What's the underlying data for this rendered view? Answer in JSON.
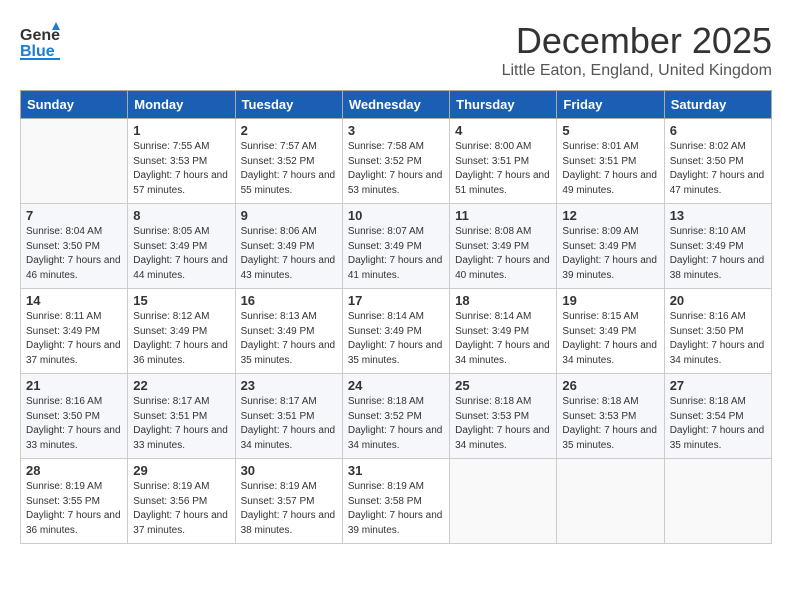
{
  "header": {
    "logo_line1": "General",
    "logo_line2": "Blue",
    "month": "December 2025",
    "location": "Little Eaton, England, United Kingdom"
  },
  "days_of_week": [
    "Sunday",
    "Monday",
    "Tuesday",
    "Wednesday",
    "Thursday",
    "Friday",
    "Saturday"
  ],
  "weeks": [
    [
      {
        "day": "",
        "sunrise": "",
        "sunset": "",
        "daylight": ""
      },
      {
        "day": "1",
        "sunrise": "Sunrise: 7:55 AM",
        "sunset": "Sunset: 3:53 PM",
        "daylight": "Daylight: 7 hours and 57 minutes."
      },
      {
        "day": "2",
        "sunrise": "Sunrise: 7:57 AM",
        "sunset": "Sunset: 3:52 PM",
        "daylight": "Daylight: 7 hours and 55 minutes."
      },
      {
        "day": "3",
        "sunrise": "Sunrise: 7:58 AM",
        "sunset": "Sunset: 3:52 PM",
        "daylight": "Daylight: 7 hours and 53 minutes."
      },
      {
        "day": "4",
        "sunrise": "Sunrise: 8:00 AM",
        "sunset": "Sunset: 3:51 PM",
        "daylight": "Daylight: 7 hours and 51 minutes."
      },
      {
        "day": "5",
        "sunrise": "Sunrise: 8:01 AM",
        "sunset": "Sunset: 3:51 PM",
        "daylight": "Daylight: 7 hours and 49 minutes."
      },
      {
        "day": "6",
        "sunrise": "Sunrise: 8:02 AM",
        "sunset": "Sunset: 3:50 PM",
        "daylight": "Daylight: 7 hours and 47 minutes."
      }
    ],
    [
      {
        "day": "7",
        "sunrise": "Sunrise: 8:04 AM",
        "sunset": "Sunset: 3:50 PM",
        "daylight": "Daylight: 7 hours and 46 minutes."
      },
      {
        "day": "8",
        "sunrise": "Sunrise: 8:05 AM",
        "sunset": "Sunset: 3:49 PM",
        "daylight": "Daylight: 7 hours and 44 minutes."
      },
      {
        "day": "9",
        "sunrise": "Sunrise: 8:06 AM",
        "sunset": "Sunset: 3:49 PM",
        "daylight": "Daylight: 7 hours and 43 minutes."
      },
      {
        "day": "10",
        "sunrise": "Sunrise: 8:07 AM",
        "sunset": "Sunset: 3:49 PM",
        "daylight": "Daylight: 7 hours and 41 minutes."
      },
      {
        "day": "11",
        "sunrise": "Sunrise: 8:08 AM",
        "sunset": "Sunset: 3:49 PM",
        "daylight": "Daylight: 7 hours and 40 minutes."
      },
      {
        "day": "12",
        "sunrise": "Sunrise: 8:09 AM",
        "sunset": "Sunset: 3:49 PM",
        "daylight": "Daylight: 7 hours and 39 minutes."
      },
      {
        "day": "13",
        "sunrise": "Sunrise: 8:10 AM",
        "sunset": "Sunset: 3:49 PM",
        "daylight": "Daylight: 7 hours and 38 minutes."
      }
    ],
    [
      {
        "day": "14",
        "sunrise": "Sunrise: 8:11 AM",
        "sunset": "Sunset: 3:49 PM",
        "daylight": "Daylight: 7 hours and 37 minutes."
      },
      {
        "day": "15",
        "sunrise": "Sunrise: 8:12 AM",
        "sunset": "Sunset: 3:49 PM",
        "daylight": "Daylight: 7 hours and 36 minutes."
      },
      {
        "day": "16",
        "sunrise": "Sunrise: 8:13 AM",
        "sunset": "Sunset: 3:49 PM",
        "daylight": "Daylight: 7 hours and 35 minutes."
      },
      {
        "day": "17",
        "sunrise": "Sunrise: 8:14 AM",
        "sunset": "Sunset: 3:49 PM",
        "daylight": "Daylight: 7 hours and 35 minutes."
      },
      {
        "day": "18",
        "sunrise": "Sunrise: 8:14 AM",
        "sunset": "Sunset: 3:49 PM",
        "daylight": "Daylight: 7 hours and 34 minutes."
      },
      {
        "day": "19",
        "sunrise": "Sunrise: 8:15 AM",
        "sunset": "Sunset: 3:49 PM",
        "daylight": "Daylight: 7 hours and 34 minutes."
      },
      {
        "day": "20",
        "sunrise": "Sunrise: 8:16 AM",
        "sunset": "Sunset: 3:50 PM",
        "daylight": "Daylight: 7 hours and 34 minutes."
      }
    ],
    [
      {
        "day": "21",
        "sunrise": "Sunrise: 8:16 AM",
        "sunset": "Sunset: 3:50 PM",
        "daylight": "Daylight: 7 hours and 33 minutes."
      },
      {
        "day": "22",
        "sunrise": "Sunrise: 8:17 AM",
        "sunset": "Sunset: 3:51 PM",
        "daylight": "Daylight: 7 hours and 33 minutes."
      },
      {
        "day": "23",
        "sunrise": "Sunrise: 8:17 AM",
        "sunset": "Sunset: 3:51 PM",
        "daylight": "Daylight: 7 hours and 34 minutes."
      },
      {
        "day": "24",
        "sunrise": "Sunrise: 8:18 AM",
        "sunset": "Sunset: 3:52 PM",
        "daylight": "Daylight: 7 hours and 34 minutes."
      },
      {
        "day": "25",
        "sunrise": "Sunrise: 8:18 AM",
        "sunset": "Sunset: 3:53 PM",
        "daylight": "Daylight: 7 hours and 34 minutes."
      },
      {
        "day": "26",
        "sunrise": "Sunrise: 8:18 AM",
        "sunset": "Sunset: 3:53 PM",
        "daylight": "Daylight: 7 hours and 35 minutes."
      },
      {
        "day": "27",
        "sunrise": "Sunrise: 8:18 AM",
        "sunset": "Sunset: 3:54 PM",
        "daylight": "Daylight: 7 hours and 35 minutes."
      }
    ],
    [
      {
        "day": "28",
        "sunrise": "Sunrise: 8:19 AM",
        "sunset": "Sunset: 3:55 PM",
        "daylight": "Daylight: 7 hours and 36 minutes."
      },
      {
        "day": "29",
        "sunrise": "Sunrise: 8:19 AM",
        "sunset": "Sunset: 3:56 PM",
        "daylight": "Daylight: 7 hours and 37 minutes."
      },
      {
        "day": "30",
        "sunrise": "Sunrise: 8:19 AM",
        "sunset": "Sunset: 3:57 PM",
        "daylight": "Daylight: 7 hours and 38 minutes."
      },
      {
        "day": "31",
        "sunrise": "Sunrise: 8:19 AM",
        "sunset": "Sunset: 3:58 PM",
        "daylight": "Daylight: 7 hours and 39 minutes."
      },
      {
        "day": "",
        "sunrise": "",
        "sunset": "",
        "daylight": ""
      },
      {
        "day": "",
        "sunrise": "",
        "sunset": "",
        "daylight": ""
      },
      {
        "day": "",
        "sunrise": "",
        "sunset": "",
        "daylight": ""
      }
    ]
  ]
}
